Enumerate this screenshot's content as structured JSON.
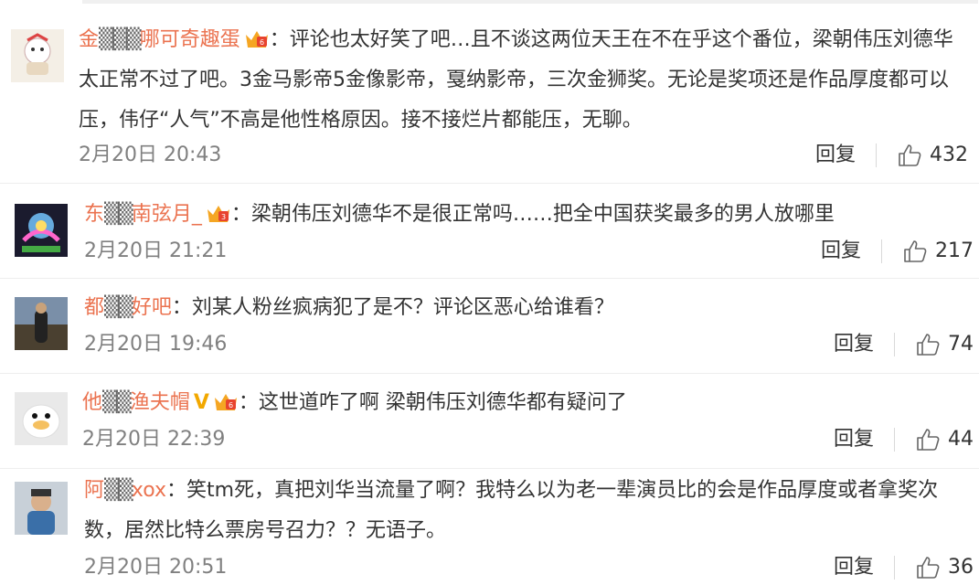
{
  "colors": {
    "username": "#eb7350",
    "text": "#333333",
    "meta": "#808080",
    "vip": "#f2a800"
  },
  "comments": [
    {
      "username": "金",
      "username_tail": "哪可奇趣蛋",
      "text": "：评论也太好笑了吧…且不谈这两位天王在不在乎这个番位，梁朝伟压刘德华太正常不过了吧。3金马影帝5金像影帝，戛纳影帝，三次金狮奖。无论是奖项还是作品厚度都可以压，伟仔“人气”不高是他性格原因。接不接烂片都能压，无聊。",
      "time": "2月20日 20:43",
      "reply": "回复",
      "likes": "432",
      "badge_icon": "vip-crown-icon"
    },
    {
      "username": "东",
      "username_tail": "南弦月_",
      "text": "：梁朝伟压刘德华不是很正常吗……把全中国获奖最多的男人放哪里",
      "time": "2月20日 21:21",
      "reply": "回复",
      "likes": "217",
      "badge_icon": "vip-crown-icon"
    },
    {
      "username": "都",
      "username_tail": "好吧",
      "text": "：刘某人粉丝疯病犯了是不？评论区恶心给谁看？",
      "time": "2月20日 19:46",
      "reply": "回复",
      "likes": "74"
    },
    {
      "username": "他",
      "username_tail": "渔夫帽",
      "text": "：这世道咋了啊 梁朝伟压刘德华都有疑问了",
      "time": "2月20日 22:39",
      "reply": "回复",
      "likes": "44",
      "verified": "V",
      "badge_icon": "vip-crown-icon"
    },
    {
      "username": "阿",
      "username_tail": "xox",
      "text": "：笑tm死，真把刘华当流量了啊？我特么以为老一辈演员比的会是作品厚度或者拿奖次数，居然比特么票房号召力？？无语子。",
      "time": "2月20日 20:51",
      "reply": "回复",
      "likes": "36"
    }
  ]
}
